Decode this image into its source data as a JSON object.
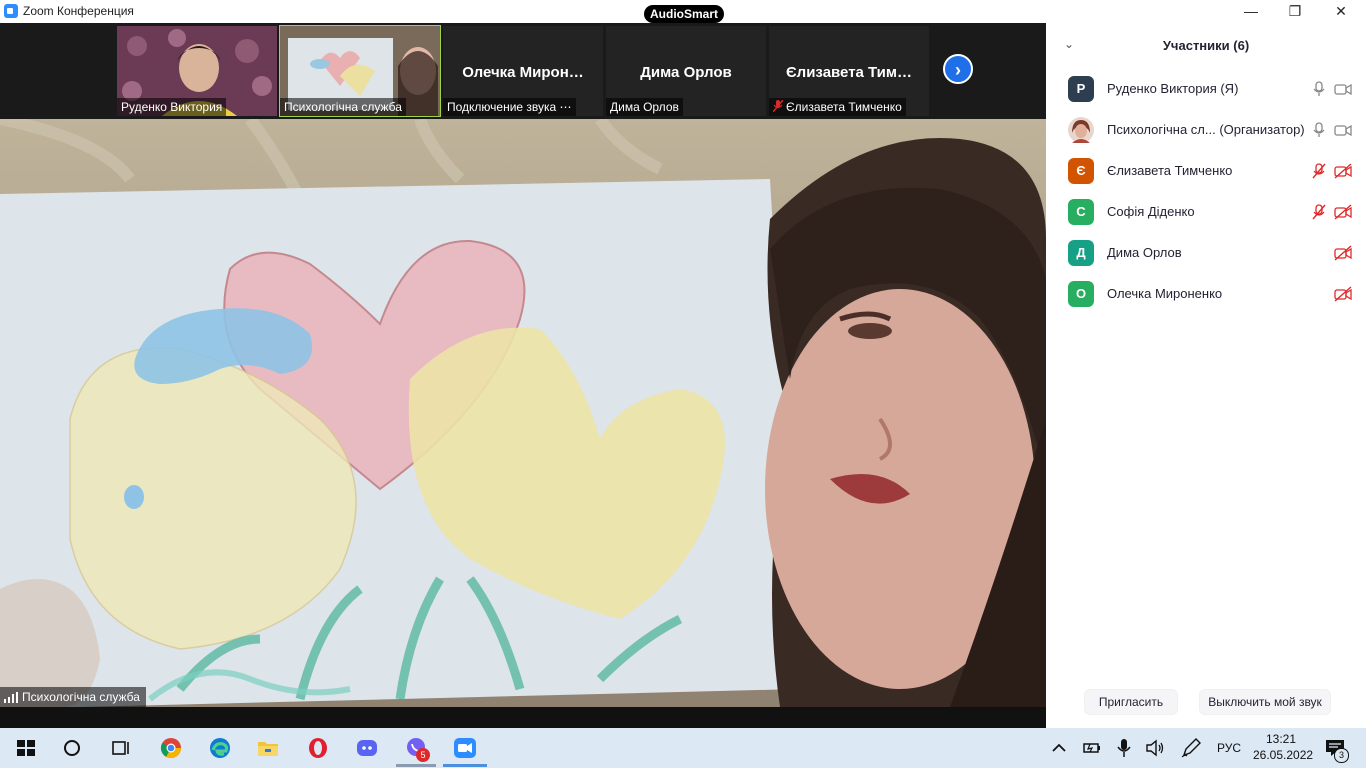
{
  "window": {
    "title": "Zoom Конференция",
    "badge": "AudioSmart",
    "minimize": "—",
    "restore": "❐",
    "close": "✕"
  },
  "thumbnails": [
    {
      "label": "Руденко  Виктория",
      "video": true
    },
    {
      "label": "Психологічна служба",
      "video": true,
      "active": true
    },
    {
      "big_name": "Олечка  Мирон…",
      "label": "Подключение звука ⋯"
    },
    {
      "big_name": "Дима Орлов",
      "label": "Дима Орлов"
    },
    {
      "big_name": "Єлизавета  Тим…",
      "label": "Єлизавета Тимченко",
      "muted": true
    }
  ],
  "strip_next": "›",
  "main": {
    "speaker_label": "Психологічна служба"
  },
  "panel": {
    "title": "Участники (6)",
    "collapse": "⌄",
    "participants": [
      {
        "initial": "Р",
        "name": "Руденко  Виктория (Я)",
        "color": "#2c3e50",
        "mic": "on",
        "cam": "on"
      },
      {
        "initial": "",
        "name": "Психологічна сл...  (Организатор)",
        "color": "#c9a99a",
        "mic": "on",
        "cam": "on",
        "photo": true
      },
      {
        "initial": "Є",
        "name": "Єлизавета Тимченко",
        "color": "#d35400",
        "mic": "off",
        "cam": "off"
      },
      {
        "initial": "С",
        "name": "Софія Діденко",
        "color": "#27ae60",
        "mic": "off",
        "cam": "off"
      },
      {
        "initial": "Д",
        "name": "Дима Орлов",
        "color": "#16a085",
        "mic": "none",
        "cam": "off"
      },
      {
        "initial": "О",
        "name": "Олечка Мироненко",
        "color": "#27ae60",
        "mic": "none",
        "cam": "off"
      }
    ],
    "invite_label": "Пригласить",
    "mute_me_label": "Выключить мой звук"
  },
  "taskbar": {
    "lang": "РУС",
    "time": "13:21",
    "date": "26.05.2022",
    "viber_badge": "5",
    "notif_count": "3"
  }
}
